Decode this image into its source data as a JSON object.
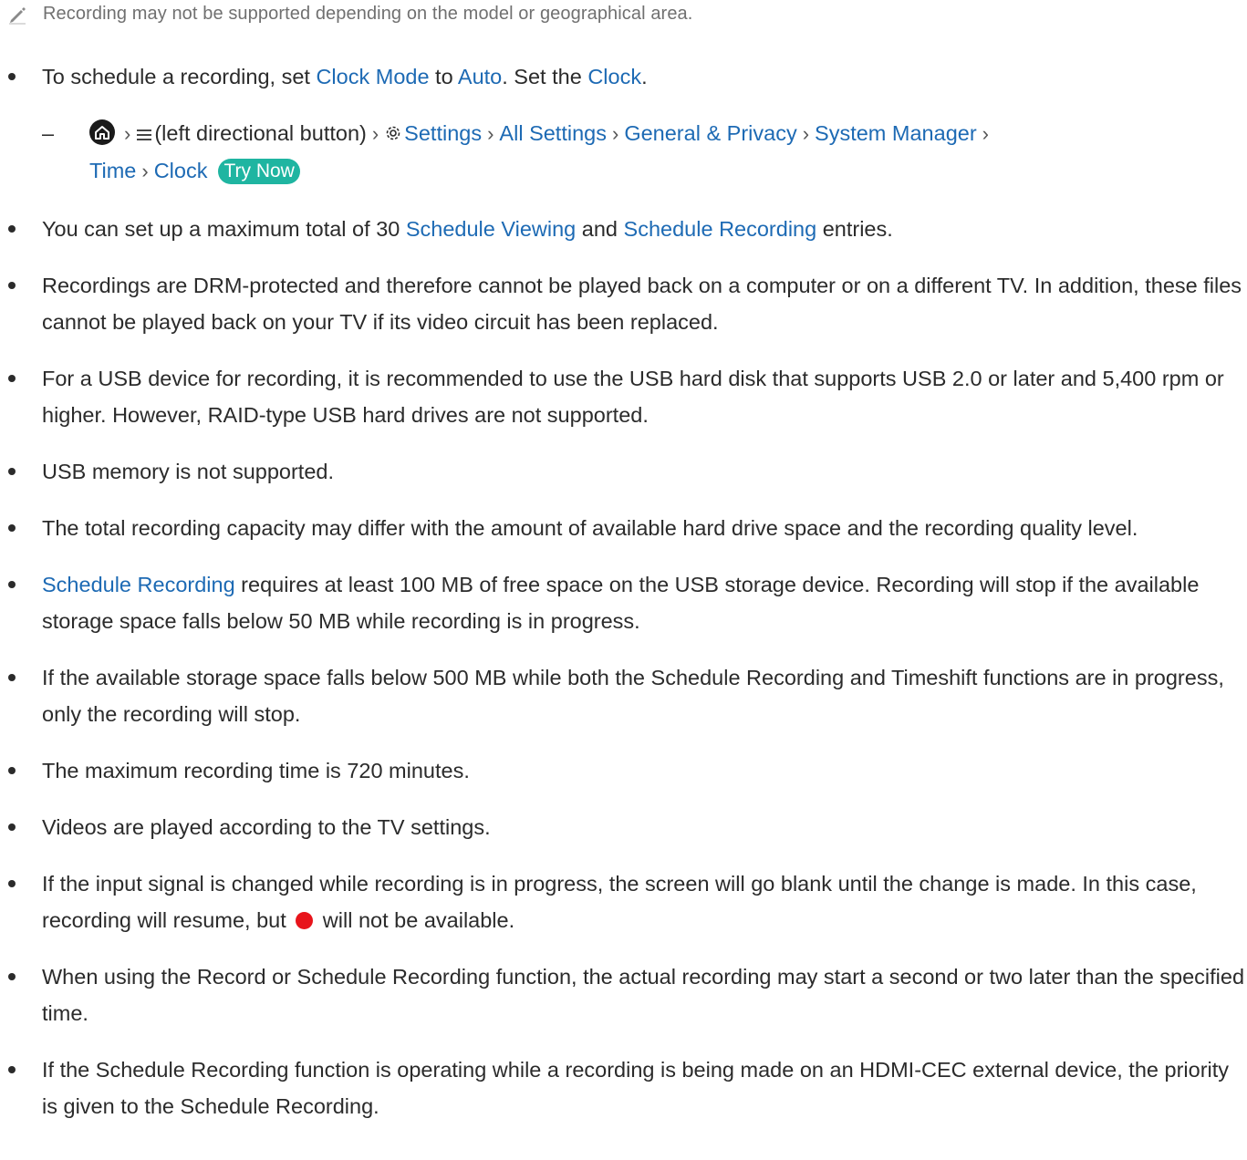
{
  "note": "Recording may not be supported depending on the model or geographical area.",
  "b1": {
    "t1": "To schedule a recording, set ",
    "l1": "Clock Mode",
    "t2": " to ",
    "l2": "Auto",
    "t3": ". Set the ",
    "l3": "Clock",
    "t4": "."
  },
  "path": {
    "menu_text": "(left directional button)",
    "settings": "Settings",
    "all_settings": "All Settings",
    "general_privacy": "General & Privacy",
    "system_manager": "System Manager",
    "time": "Time",
    "clock": "Clock",
    "try_now": "Try Now"
  },
  "b2": {
    "t1": "You can set up a maximum total of 30 ",
    "l1": "Schedule Viewing",
    "t2": " and ",
    "l2": "Schedule Recording",
    "t3": " entries."
  },
  "b3": "Recordings are DRM-protected and therefore cannot be played back on a computer or on a different TV. In addition, these files cannot be played back on your TV if its video circuit has been replaced.",
  "b4": "For a USB device for recording, it is recommended to use the USB hard disk that supports USB 2.0 or later and 5,400 rpm or higher. However, RAID-type USB hard drives are not supported.",
  "b5": "USB memory is not supported.",
  "b6": "The total recording capacity may differ with the amount of available hard drive space and the recording quality level.",
  "b7": {
    "l1": "Schedule Recording",
    "t1": " requires at least 100 MB of free space on the USB storage device. Recording will stop if the available storage space falls below 50 MB while recording is in progress."
  },
  "b8": "If the available storage space falls below 500 MB while both the Schedule Recording and Timeshift functions are in progress, only the recording will stop.",
  "b9": "The maximum recording time is 720 minutes.",
  "b10": "Videos are played according to the TV settings.",
  "b11": {
    "t1": "If the input signal is changed while recording is in progress, the screen will go blank until the change is made. In this case, recording will resume, but ",
    "t2": " will not be available."
  },
  "b12": "When using the Record or Schedule Recording function, the actual recording may start a second or two later than the specified time.",
  "b13": "If the Schedule Recording function is operating while a recording is being made on an HDMI-CEC external device, the priority is given to the Schedule Recording.",
  "colors": {
    "link": "#1d6ab4",
    "try_now_bg": "#1fb5a1",
    "record_dot": "#e8141b"
  },
  "icons": [
    "pencil-note-icon",
    "home-icon",
    "menu-icon",
    "gear-icon",
    "chevron-right-icon",
    "record-dot-icon"
  ]
}
